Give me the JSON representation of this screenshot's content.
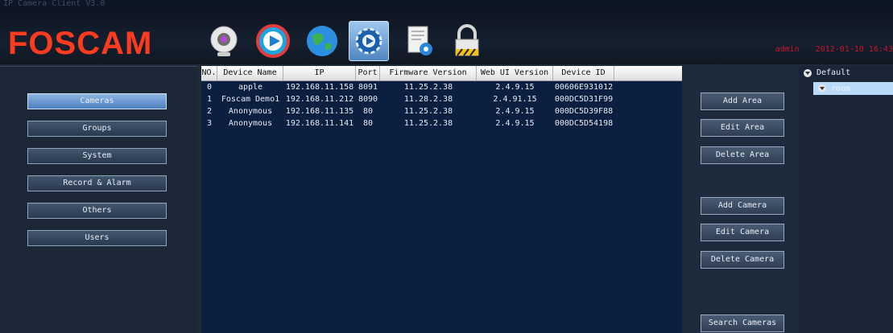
{
  "window": {
    "title": "IP Camera Client V3.0"
  },
  "brand": {
    "logo_text": "FOSCAM"
  },
  "toolbar": {
    "icons": [
      {
        "name": "webcam-icon",
        "active": false
      },
      {
        "name": "play-icon",
        "active": false
      },
      {
        "name": "globe-icon",
        "active": false
      },
      {
        "name": "settings-gear-icon",
        "active": true
      },
      {
        "name": "log-document-icon",
        "active": false
      },
      {
        "name": "lock-icon",
        "active": false
      }
    ]
  },
  "user": {
    "name": "admin",
    "datetime": "2012-01-10  16:43"
  },
  "nav": {
    "items": [
      {
        "label": "Cameras",
        "selected": true
      },
      {
        "label": "Groups",
        "selected": false
      },
      {
        "label": "System",
        "selected": false
      },
      {
        "label": "Record & Alarm",
        "selected": false
      },
      {
        "label": "Others",
        "selected": false
      },
      {
        "label": "Users",
        "selected": false
      }
    ]
  },
  "table": {
    "columns": [
      "NO.",
      "Device Name",
      "IP",
      "Port",
      "Firmware Version",
      "Web UI Version",
      "Device ID"
    ],
    "rows": [
      [
        "0",
        "apple",
        "192.168.11.158",
        "8091",
        "11.25.2.38",
        "2.4.9.15",
        "00606E931012"
      ],
      [
        "1",
        "Foscam Demo1",
        "192.168.11.212",
        "8090",
        "11.28.2.38",
        "2.4.91.15",
        "000DC5D31F99"
      ],
      [
        "2",
        "Anonymous",
        "192.168.11.135",
        "80",
        "11.25.2.38",
        "2.4.9.15",
        "000DC5D39F88"
      ],
      [
        "3",
        "Anonymous",
        "192.168.11.141",
        "80",
        "11.25.2.38",
        "2.4.9.15",
        "000DC5D54198"
      ]
    ]
  },
  "actions": {
    "add_area": "Add Area",
    "edit_area": "Edit Area",
    "delete_area": "Delete Area",
    "add_camera": "Add Camera",
    "edit_camera": "Edit Camera",
    "delete_camera": "Delete Camera",
    "search_cameras": "Search Cameras"
  },
  "tree": {
    "root_label": "Default",
    "child_label": "room"
  },
  "colors": {
    "logo": "#ff3b1f",
    "accent": "#c9172b",
    "selection": "#b9dbf9"
  }
}
